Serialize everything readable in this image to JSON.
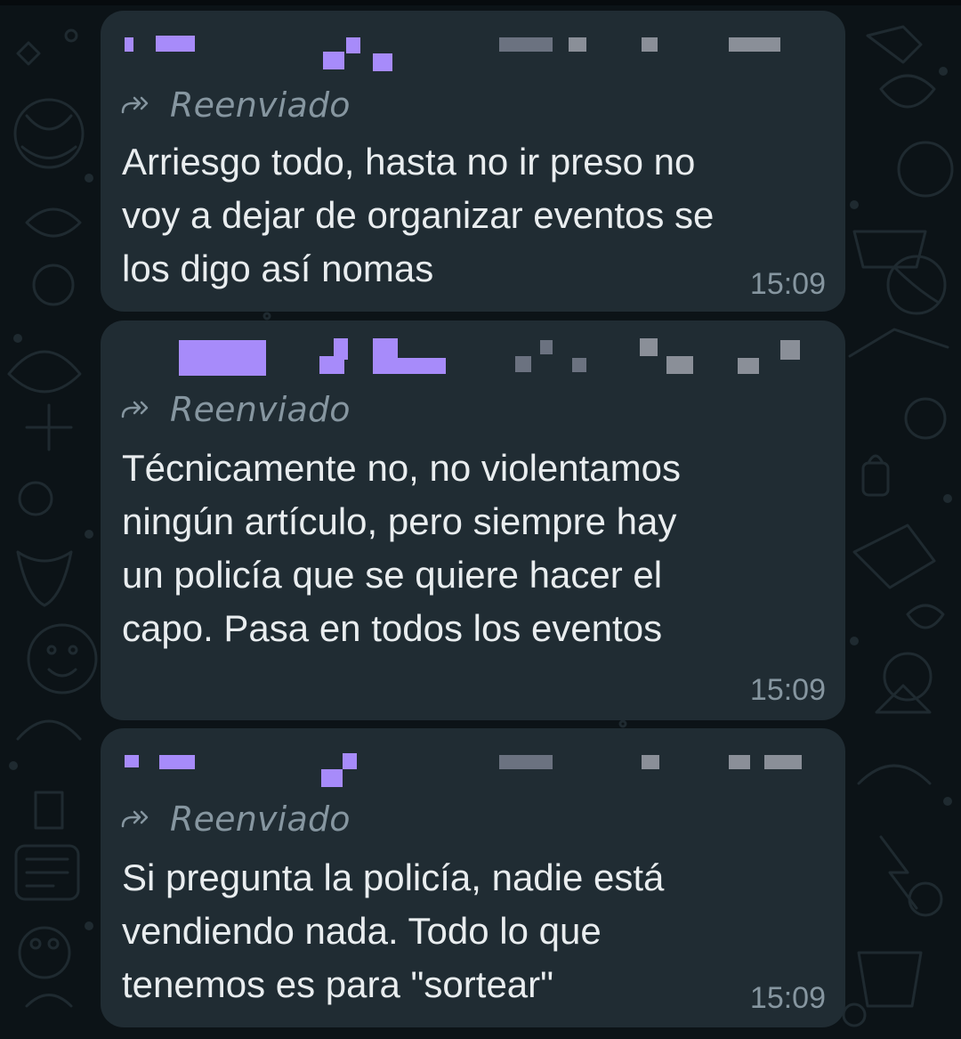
{
  "chat": {
    "messages": [
      {
        "forwarded_label": "Reenviado",
        "text": "Arriesgo todo, hasta no ir preso no\nvoy a dejar de organizar eventos se\nlos digo así nomas",
        "time": "15:09"
      },
      {
        "forwarded_label": "Reenviado",
        "text": "Técnicamente no, no violentamos\nningún artículo, pero siempre hay\nun policía que se quiere hacer el\ncapo. Pasa en todos los eventos",
        "time": "15:09"
      },
      {
        "forwarded_label": "Reenviado",
        "text": "Si pregunta la policía, nadie está\nvendiendo nada. Todo lo que\ntenemos es para \"sortear\"",
        "time": "15:09"
      }
    ]
  },
  "colors": {
    "background": "#0c1317",
    "bubble": "#202c33",
    "message_text": "#e9edef",
    "meta_text": "#8696a0",
    "sender_redaction": "#a78bfa"
  },
  "icons": {
    "forwarded": "forward-arrow-icon"
  }
}
